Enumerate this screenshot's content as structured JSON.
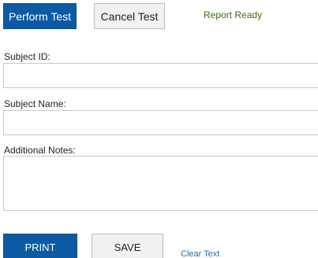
{
  "toolbar": {
    "perform_label": "Perform Test",
    "cancel_label": "Cancel Test",
    "status": "Report Ready"
  },
  "form": {
    "subject_id": {
      "label": "Subject ID:",
      "value": ""
    },
    "subject_name": {
      "label": "Subject Name:",
      "value": ""
    },
    "notes": {
      "label": "Additional Notes:",
      "value": ""
    }
  },
  "actions": {
    "print_label": "PRINT",
    "save_label": "SAVE",
    "clear_label": "Clear Text"
  },
  "colors": {
    "primary": "#0b5aa3",
    "secondary_bg": "#f1f1f1",
    "status": "#3b6e0f",
    "link": "#2b6cb0"
  }
}
